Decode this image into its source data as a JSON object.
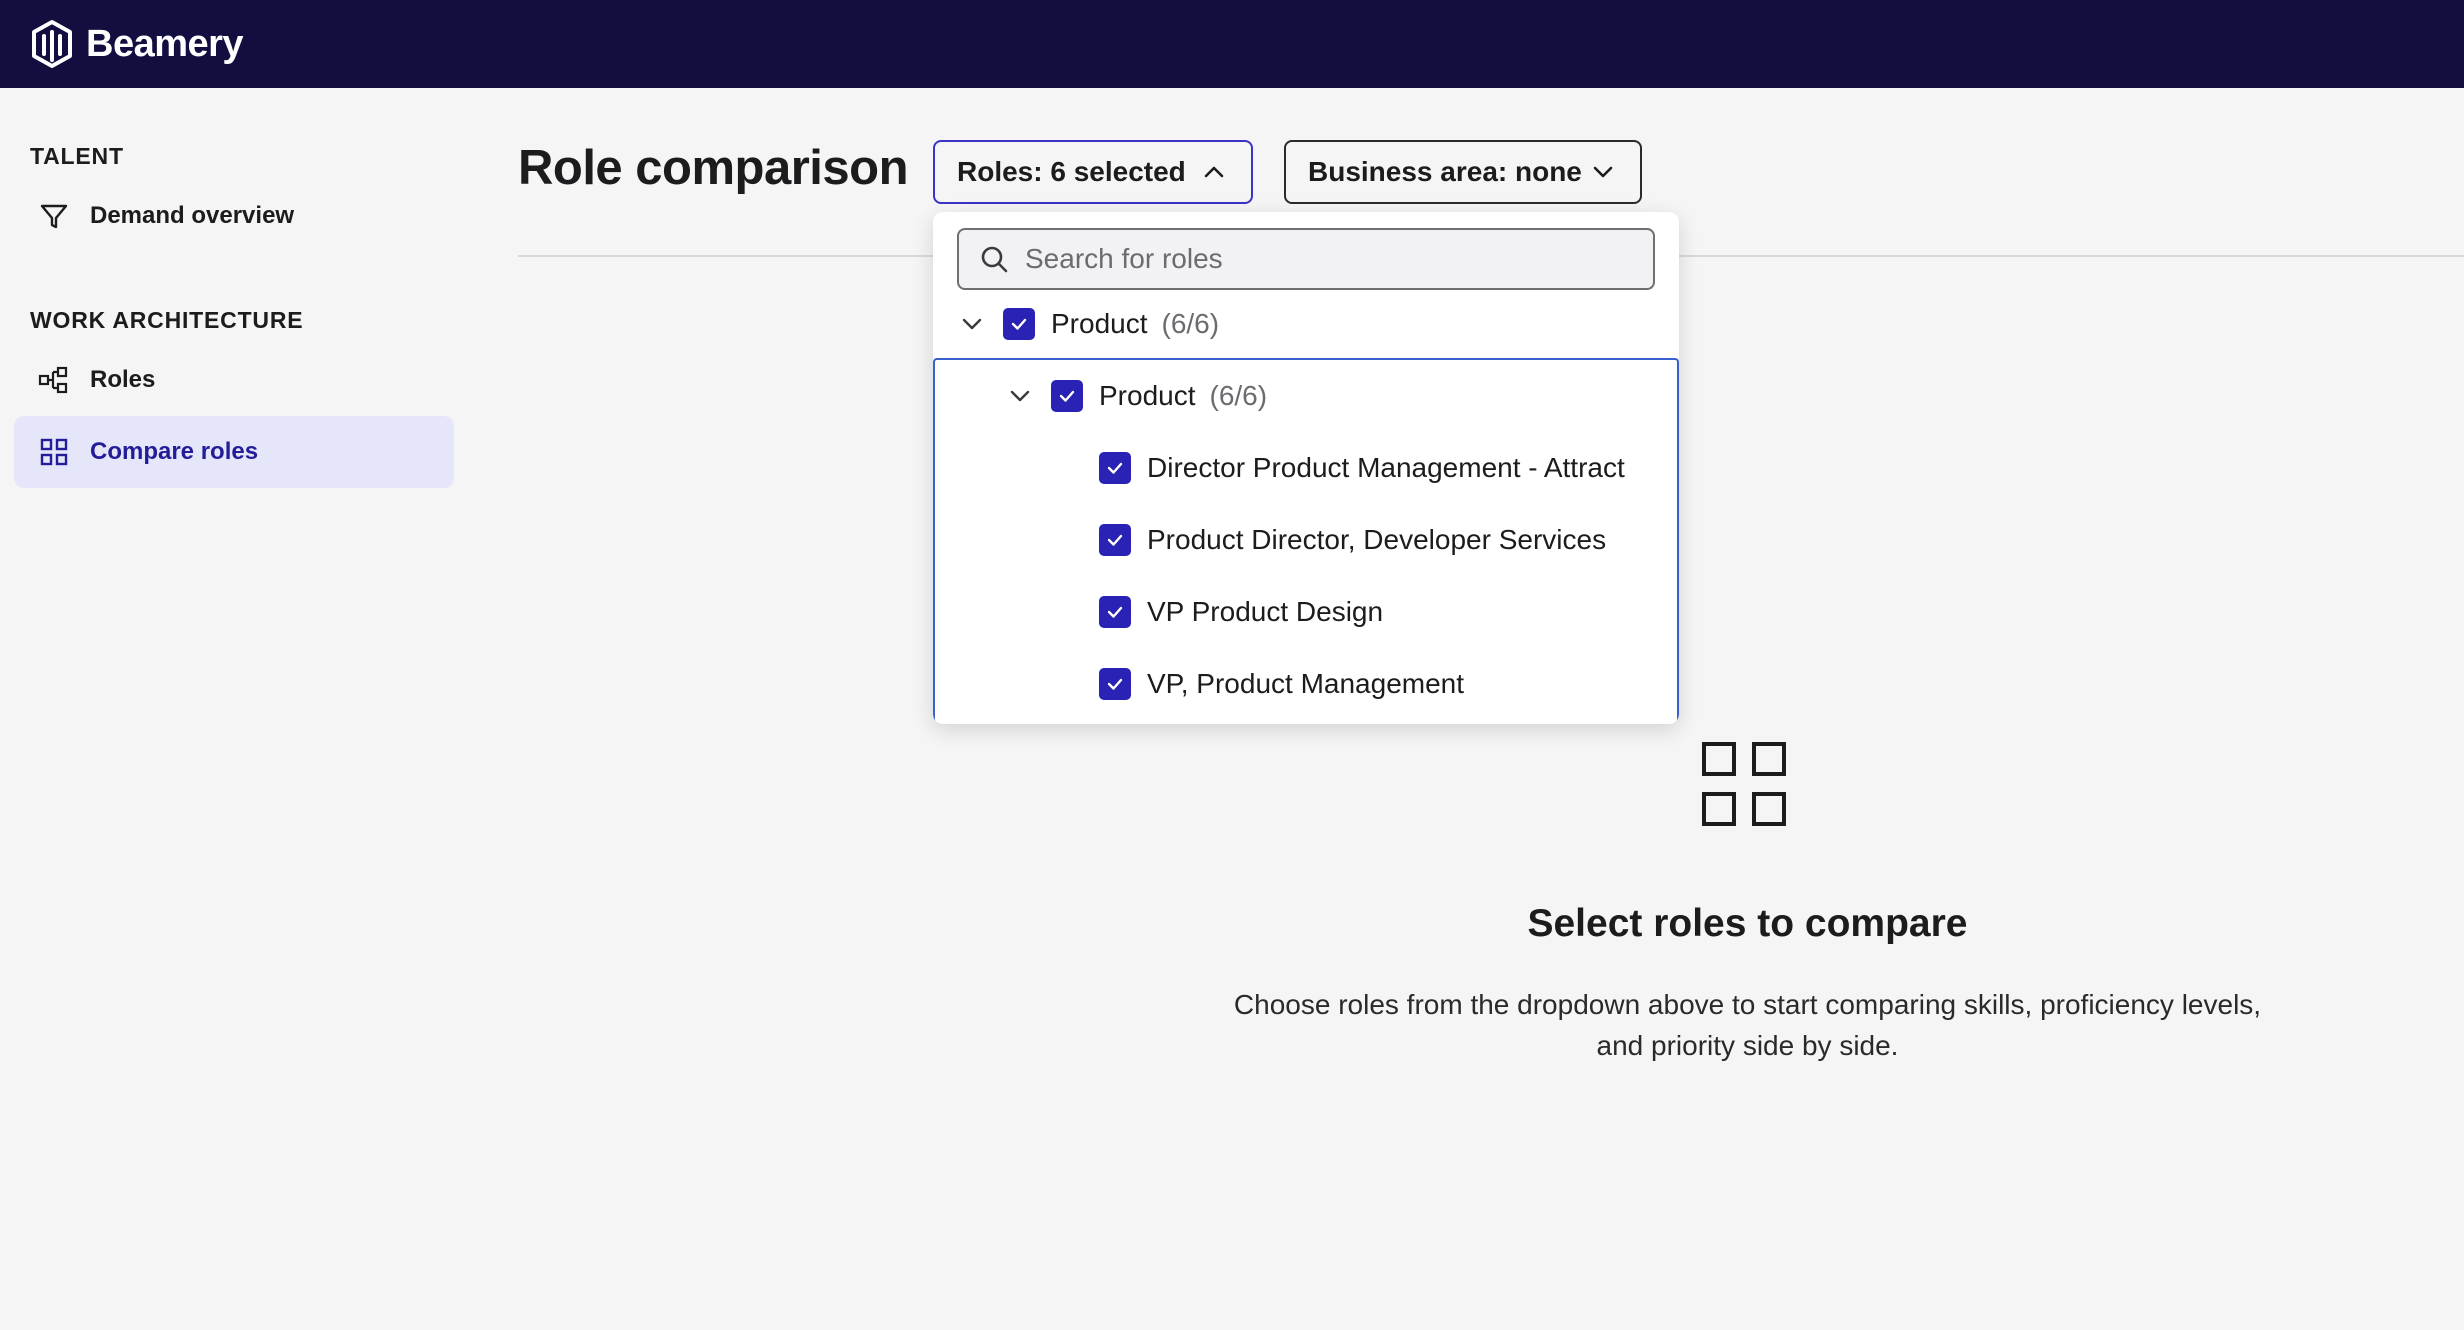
{
  "app": {
    "brand": "Beamery"
  },
  "sidebar": {
    "sections": [
      {
        "title": "TALENT"
      },
      {
        "title": "WORK ARCHITECTURE"
      }
    ],
    "items": [
      {
        "label": "Demand overview",
        "icon": "filter-icon"
      },
      {
        "label": "Roles",
        "icon": "hierarchy-icon"
      },
      {
        "label": "Compare roles",
        "icon": "grid-icon",
        "active": true
      }
    ]
  },
  "header": {
    "title": "Role comparison",
    "roles_filter": "Roles: 6 selected",
    "business_filter": "Business area: none"
  },
  "dropdown": {
    "search_placeholder": "Search for roles",
    "groups": [
      {
        "label": "Product",
        "count": "(6/6)",
        "checked": true,
        "expanded": true
      },
      {
        "label": "Product",
        "count": "(6/6)",
        "checked": true,
        "expanded": true
      }
    ],
    "roles": [
      {
        "label": "Director Product Management - Attract",
        "checked": true
      },
      {
        "label": "Product Director, Developer Services",
        "checked": true
      },
      {
        "label": "VP Product Design",
        "checked": true
      },
      {
        "label": "VP, Product Management",
        "checked": true
      }
    ]
  },
  "empty_state": {
    "title": "Select roles to compare",
    "description": "Choose roles from the dropdown above to start comparing skills, proficiency levels, and priority side by side."
  },
  "colors": {
    "topbar": "#120f40",
    "accent": "#2a22b5",
    "active_nav_bg": "#e6e6fa"
  }
}
